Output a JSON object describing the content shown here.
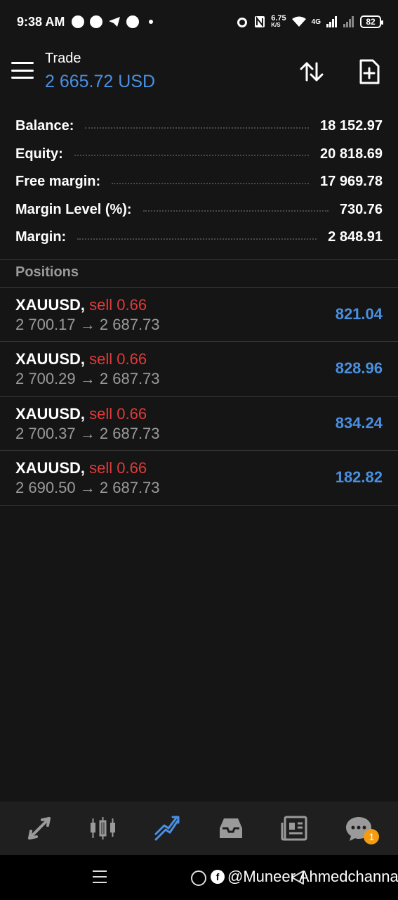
{
  "status": {
    "time": "9:38 AM",
    "net_speed_value": "6.75",
    "net_speed_unit": "K/S",
    "network": "4G",
    "battery": "82"
  },
  "header": {
    "title": "Trade",
    "subtitle": "2 665.72 USD"
  },
  "summary": [
    {
      "label": "Balance:",
      "value": "18 152.97"
    },
    {
      "label": "Equity:",
      "value": "20 818.69"
    },
    {
      "label": "Free margin:",
      "value": "17 969.78"
    },
    {
      "label": "Margin Level (%):",
      "value": "730.76"
    },
    {
      "label": "Margin:",
      "value": "2 848.91"
    }
  ],
  "positions_header": "Positions",
  "positions": [
    {
      "symbol": "XAUUSD,",
      "side": "sell 0.66",
      "open": "2 700.17",
      "arrow": "→",
      "current": "2 687.73",
      "profit": "821.04"
    },
    {
      "symbol": "XAUUSD,",
      "side": "sell 0.66",
      "open": "2 700.29",
      "arrow": "→",
      "current": "2 687.73",
      "profit": "828.96"
    },
    {
      "symbol": "XAUUSD,",
      "side": "sell 0.66",
      "open": "2 700.37",
      "arrow": "→",
      "current": "2 687.73",
      "profit": "834.24"
    },
    {
      "symbol": "XAUUSD,",
      "side": "sell 0.66",
      "open": "2 690.50",
      "arrow": "→",
      "current": "2 687.73",
      "profit": "182.82"
    }
  ],
  "bottom_nav": {
    "items": [
      {
        "icon": "quotes-icon",
        "active": false
      },
      {
        "icon": "chart-candles-icon",
        "active": false
      },
      {
        "icon": "trade-icon",
        "active": true
      },
      {
        "icon": "history-inbox-icon",
        "active": false
      },
      {
        "icon": "news-icon",
        "active": false
      },
      {
        "icon": "messages-icon",
        "active": false
      }
    ],
    "messages_badge": "1"
  },
  "watermark": "@Muneer Ahmedchanna",
  "colors": {
    "accent_blue": "#4a90e2",
    "sell_red": "#e03a3a",
    "badge_orange": "#f39c12",
    "background": "#151515"
  }
}
